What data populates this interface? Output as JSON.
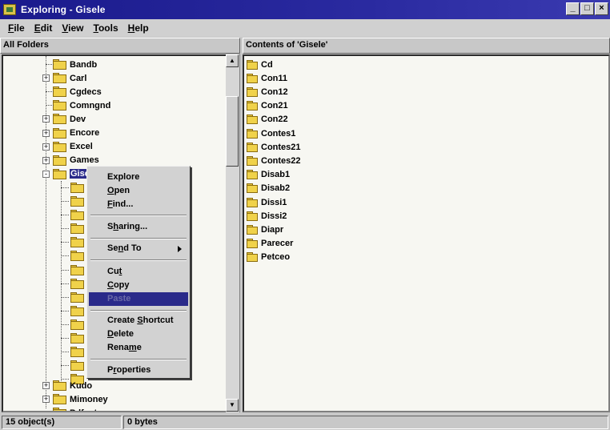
{
  "window": {
    "title": "Exploring - Gisele"
  },
  "menu": [
    {
      "label": "File",
      "u": "F",
      "rest": "ile"
    },
    {
      "label": "Edit",
      "u": "E",
      "rest": "dit"
    },
    {
      "label": "View",
      "u": "V",
      "rest": "iew"
    },
    {
      "label": "Tools",
      "u": "T",
      "rest": "ools"
    },
    {
      "label": "Help",
      "u": "H",
      "rest": "elp"
    }
  ],
  "headers": {
    "left": "All Folders",
    "right": "Contents of 'Gisele'"
  },
  "tree": [
    {
      "label": "Bandb",
      "expander": ""
    },
    {
      "label": "Carl",
      "expander": "+"
    },
    {
      "label": "Cgdecs",
      "expander": ""
    },
    {
      "label": "Comngnd",
      "expander": ""
    },
    {
      "label": "Dev",
      "expander": "+"
    },
    {
      "label": "Encore",
      "expander": "+"
    },
    {
      "label": "Excel",
      "expander": "+"
    },
    {
      "label": "Games",
      "expander": "+"
    },
    {
      "label": "Gisele",
      "expander": "-"
    }
  ],
  "tree_bottom": [
    {
      "label": "Kudo",
      "expander": "+"
    },
    {
      "label": "Mimoney",
      "expander": "+"
    },
    {
      "label": "Pdfnets",
      "expander": ""
    }
  ],
  "subfolder_count": 15,
  "contents": [
    "Cd",
    "Con11",
    "Con12",
    "Con21",
    "Con22",
    "Contes1",
    "Contes21",
    "Contes22",
    "Disab1",
    "Disab2",
    "Dissi1",
    "Dissi2",
    "Diapr",
    "Parecer",
    "Petceo"
  ],
  "context_menu": [
    {
      "label": "Explore",
      "pre": "",
      "u": "",
      "post": "Explore"
    },
    {
      "label": "Open",
      "pre": "",
      "u": "O",
      "post": "pen"
    },
    {
      "label": "Find...",
      "pre": "",
      "u": "F",
      "post": "ind..."
    },
    {
      "label": "Sharing...",
      "pre": "S",
      "u": "h",
      "post": "aring..."
    },
    {
      "label": "Send To",
      "pre": "Se",
      "u": "n",
      "post": "d To"
    },
    {
      "label": "Cut",
      "pre": "Cu",
      "u": "t",
      "post": ""
    },
    {
      "label": "Copy",
      "pre": "",
      "u": "C",
      "post": "opy"
    },
    {
      "label": "Paste",
      "pre": "",
      "u": "",
      "post": "Paste"
    },
    {
      "label": "Create Shortcut",
      "pre": "Create ",
      "u": "S",
      "post": "hortcut"
    },
    {
      "label": "Delete",
      "pre": "",
      "u": "D",
      "post": "elete"
    },
    {
      "label": "Rename",
      "pre": "Rena",
      "u": "m",
      "post": "e"
    },
    {
      "label": "Properties",
      "pre": "P",
      "u": "r",
      "post": "operties"
    }
  ],
  "status": {
    "objects": "15 object(s)",
    "size": "0 bytes"
  },
  "colors": {
    "titlebar": "#1a1a8c",
    "selection": "#2a2a8a",
    "folder": "#f0d24a"
  }
}
